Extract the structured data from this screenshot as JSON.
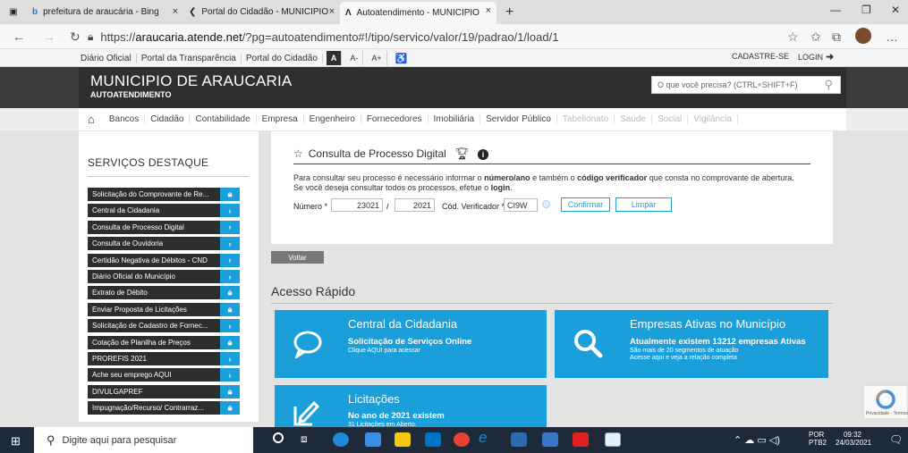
{
  "browser": {
    "tabs": [
      {
        "label": "prefeitura de araucária - Bing"
      },
      {
        "label": "Portal do Cidadão - MUNICIPIO"
      },
      {
        "label": "Autoatendimento - MUNICIPIO"
      }
    ],
    "url_prefix": "https://",
    "url_domain": "araucaria.atende.net",
    "url_path": "/?pg=autoatendimento#!/tipo/servico/valor/19/padrao/1/load/1"
  },
  "topbar": {
    "links": [
      "Diário Oficial",
      "Portal da Transparência",
      "Portal do Cidadão"
    ],
    "font_a": "A",
    "font_minus": "A-",
    "font_plus": "A+",
    "cadastre": "CADASTRE-SE",
    "login": "LOGIN"
  },
  "header": {
    "title": "MUNICIPIO DE ARAUCARIA",
    "subtitle": "AUTOATENDIMENTO",
    "search_placeholder": "O que você precisa? (CTRL+SHIFT+F)"
  },
  "menu": {
    "items": [
      "Bancos",
      "Cidadão",
      "Contabilidade",
      "Empresa",
      "Engenheiro",
      "Fornecedores",
      "Imobiliária",
      "Servidor Público"
    ],
    "dim_items": [
      "Tabelionato",
      "Saúde",
      "Social",
      "Vigilância"
    ]
  },
  "sidebar": {
    "title": "SERVIÇOS DESTAQUE",
    "items": [
      {
        "label": "Solicitação do Comprovante de Re...",
        "icon": "lock"
      },
      {
        "label": "Central da Cidadania",
        "icon": "arrow"
      },
      {
        "label": "Consulta de Processo Digital",
        "icon": "arrow"
      },
      {
        "label": "Consulta de Ouvidoria",
        "icon": "arrow"
      },
      {
        "label": "Certidão Negativa de Débitos - CND",
        "icon": "arrow"
      },
      {
        "label": "Diário Oficial do Município",
        "icon": "arrow"
      },
      {
        "label": "Extrato de Débito",
        "icon": "lock"
      },
      {
        "label": "Enviar Proposta de Licitações",
        "icon": "lock"
      },
      {
        "label": "Solicitação de Cadastro de Fornec...",
        "icon": "arrow"
      },
      {
        "label": "Cotação de Planilha de Preços",
        "icon": "lock"
      },
      {
        "label": "PROREFIS 2021",
        "icon": "arrow"
      },
      {
        "label": "Ache seu emprego AQUI",
        "icon": "arrow"
      },
      {
        "label": "DIVULGAPREF",
        "icon": "lock"
      },
      {
        "label": "Impugnação/Recurso/ Contrarraz...",
        "icon": "lock"
      }
    ]
  },
  "form": {
    "title": "Consulta de Processo Digital",
    "text1_a": "Para consultar seu processo é necessário informar o ",
    "text1_b": "número/ano",
    "text1_c": " e também o ",
    "text1_d": "código verificador",
    "text1_e": " que consta no comprovante de abertura.",
    "text2_a": "Se você deseja consultar todos os processos, efetue o ",
    "text2_b": "login",
    "text2_c": ".",
    "numero_label": "Número *",
    "numero_value": "23021",
    "slash": "/",
    "ano_value": "2021",
    "cod_label": "Cód. Verificador *",
    "cod_value": "CI9W",
    "confirm": "Confirmar",
    "limpar": "Limpar",
    "voltar": "Voltar"
  },
  "acesso": {
    "title": "Acesso Rápido",
    "cards": [
      {
        "title": "Central da Cidadania",
        "sub": "Solicitação de Serviços Online",
        "desc": "Clique AQUI para acessar"
      },
      {
        "title": "Empresas Ativas no Município",
        "sub": "Atualmente existem 13212 empresas Ativas",
        "desc": "São mais de 20 segmentos de atuação",
        "desc2": "Acesse aqui e veja a relação completa"
      },
      {
        "title": "Licitações",
        "sub": "No ano de 2021 existem",
        "desc": "31 Licitações em Aberto."
      }
    ]
  },
  "taskbar": {
    "search": "Digite aqui para pesquisar",
    "lang1": "POR",
    "lang2": "PTB2",
    "time": "09:32",
    "date": "24/03/2021"
  },
  "recaptcha": "Privacidade - Termos",
  "colors": {
    "accent": "#1a9fda",
    "dark": "#2f2f2f"
  }
}
